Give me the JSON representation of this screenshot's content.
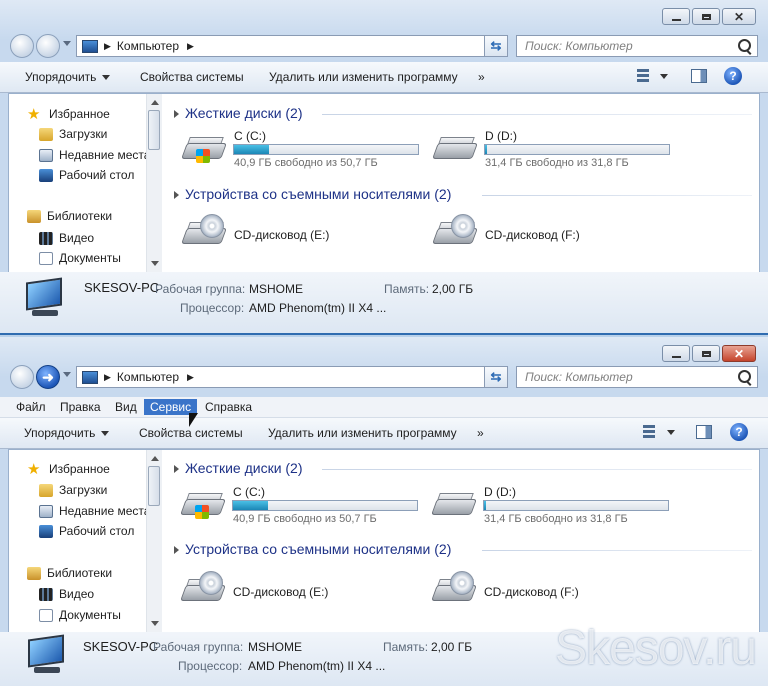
{
  "windows": [
    {
      "address": "Компьютер",
      "search_placeholder": "Поиск: Компьютер",
      "menubar": null,
      "toolbar": {
        "organize": "Упорядочить",
        "system_properties": "Свойства системы",
        "uninstall": "Удалить или изменить программу",
        "more": "»"
      },
      "nav": {
        "favorites": "Избранное",
        "downloads": "Загрузки",
        "recent": "Недавние места",
        "desktop": "Рабочий стол",
        "libraries": "Библиотеки",
        "video": "Видео",
        "documents": "Документы"
      },
      "groups": {
        "hdd": "Жесткие диски (2)",
        "removable": "Устройства со съемными носителями (2)"
      },
      "drives": [
        {
          "name": "C (C:)",
          "free": "40,9 ГБ свободно из 50,7 ГБ",
          "used_fraction": 0.19
        },
        {
          "name": "D (D:)",
          "free": "31,4 ГБ свободно из 31,8 ГБ",
          "used_fraction": 0.01
        }
      ],
      "cd": [
        {
          "name": "CD-дисковод (E:)"
        },
        {
          "name": "CD-дисковод (F:)"
        }
      ],
      "details": {
        "pcname": "SKESOV-PC",
        "workgroup_label": "Рабочая группа:",
        "workgroup": "MSHOME",
        "memory_label": "Память:",
        "memory": "2,00 ГБ",
        "cpu_label": "Процессор:",
        "cpu": "AMD Phenom(tm) II X4 ..."
      }
    },
    {
      "address": "Компьютер",
      "search_placeholder": "Поиск: Компьютер",
      "menubar": {
        "file": "Файл",
        "edit": "Правка",
        "view": "Вид",
        "tools": "Сервис",
        "help": "Справка"
      },
      "toolbar": {
        "organize": "Упорядочить",
        "system_properties": "Свойства системы",
        "uninstall": "Удалить или изменить программу",
        "more": "»"
      },
      "nav": {
        "favorites": "Избранное",
        "downloads": "Загрузки",
        "recent": "Недавние места",
        "desktop": "Рабочий стол",
        "libraries": "Библиотеки",
        "video": "Видео",
        "documents": "Документы"
      },
      "groups": {
        "hdd": "Жесткие диски (2)",
        "removable": "Устройства со съемными носителями (2)"
      },
      "drives": [
        {
          "name": "C (C:)",
          "free": "40,9 ГБ свободно из 50,7 ГБ",
          "used_fraction": 0.19
        },
        {
          "name": "D (D:)",
          "free": "31,4 ГБ свободно из 31,8 ГБ",
          "used_fraction": 0.01
        }
      ],
      "cd": [
        {
          "name": "CD-дисковод (E:)"
        },
        {
          "name": "CD-дисковод (F:)"
        }
      ],
      "details": {
        "pcname": "SKESOV-PC",
        "workgroup_label": "Рабочая группа:",
        "workgroup": "MSHOME",
        "memory_label": "Память:",
        "memory": "2,00 ГБ",
        "cpu_label": "Процессор:",
        "cpu": "AMD Phenom(tm) II X4 ..."
      }
    }
  ],
  "watermark": "Skesov.ru",
  "colors": {
    "menu_highlight": "#3a74c9",
    "group_title": "#1e3287",
    "bar_fill": "#1b86b6"
  },
  "icons": [
    "back-icon",
    "forward-icon",
    "computer-icon",
    "refresh-icon",
    "search-icon",
    "hard-drive-icon",
    "cd-drive-icon",
    "star-icon",
    "folder-icon",
    "help-icon"
  ]
}
